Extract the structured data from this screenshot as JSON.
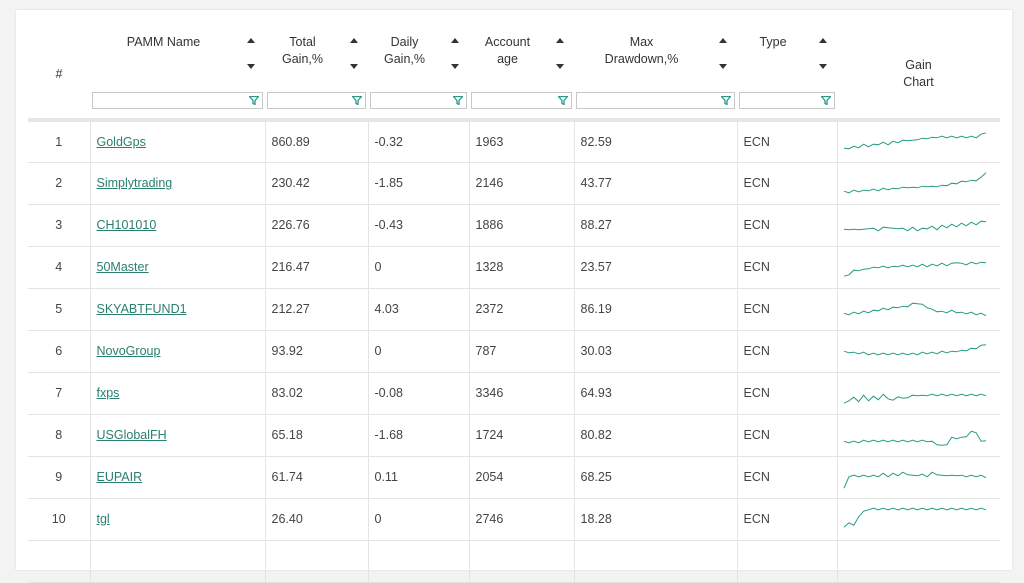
{
  "headers": {
    "num": "#",
    "name": "PAMM Name",
    "gain": [
      "Total",
      "Gain,%"
    ],
    "daily": [
      "Daily",
      "Gain,%"
    ],
    "age": [
      "Account",
      "age"
    ],
    "dd": [
      "Max",
      "Drawdown,%"
    ],
    "type": "Type",
    "chart": [
      "Gain",
      "Chart"
    ]
  },
  "accent_color": "#2a9a86",
  "filter_icon": "funnel-icon",
  "rows": [
    {
      "num": "1",
      "name": "GoldGps",
      "gain": "860.89",
      "daily": "-0.32",
      "age": "1963",
      "dd": "82.59",
      "type": "ECN"
    },
    {
      "num": "2",
      "name": "Simplytrading",
      "gain": "230.42",
      "daily": "-1.85",
      "age": "2146",
      "dd": "43.77",
      "type": "ECN"
    },
    {
      "num": "3",
      "name": "CH101010",
      "gain": "226.76",
      "daily": "-0.43",
      "age": "1886",
      "dd": "88.27",
      "type": "ECN"
    },
    {
      "num": "4",
      "name": "50Master",
      "gain": "216.47",
      "daily": "0",
      "age": "1328",
      "dd": "23.57",
      "type": "ECN"
    },
    {
      "num": "5",
      "name": "SKYABTFUND1",
      "gain": "212.27",
      "daily": "4.03",
      "age": "2372",
      "dd": "86.19",
      "type": "ECN"
    },
    {
      "num": "6",
      "name": "NovoGroup",
      "gain": "93.92",
      "daily": "0",
      "age": "787",
      "dd": "30.03",
      "type": "ECN"
    },
    {
      "num": "7",
      "name": "fxps",
      "gain": "83.02",
      "daily": "-0.08",
      "age": "3346",
      "dd": "64.93",
      "type": "ECN"
    },
    {
      "num": "8",
      "name": "USGlobalFH",
      "gain": "65.18",
      "daily": "-1.68",
      "age": "1724",
      "dd": "80.82",
      "type": "ECN"
    },
    {
      "num": "9",
      "name": "EUPAIR",
      "gain": "61.74",
      "daily": "0.11",
      "age": "2054",
      "dd": "68.25",
      "type": "ECN"
    },
    {
      "num": "10",
      "name": "tgl",
      "gain": "26.40",
      "daily": "0",
      "age": "2746",
      "dd": "18.28",
      "type": "ECN"
    },
    {
      "num": "",
      "name": "",
      "gain": "",
      "daily": "",
      "age": "",
      "dd": "",
      "type": ""
    }
  ]
}
